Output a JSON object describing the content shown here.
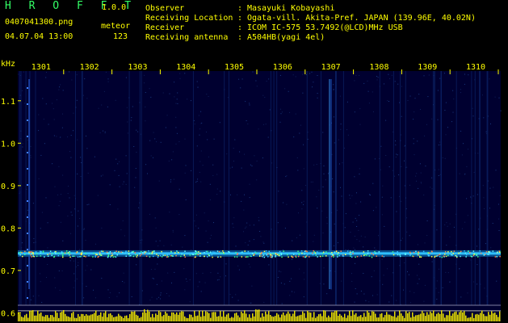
{
  "header": {
    "app_name": "H R O F F T",
    "version": "1.0.0",
    "filename": "0407041300.png",
    "meteor_label": "meteor",
    "datetime": "04.07.04 13:00",
    "meteor_count": "123"
  },
  "info": [
    {
      "key": "Observer",
      "value": "Masayuki Kobayashi"
    },
    {
      "key": "Receiving Location",
      "value": "Ogata-vill. Akita-Pref. JAPAN (139.96E, 40.02N)"
    },
    {
      "key": "Receiver",
      "value": "ICOM IC-575 53.7492(@LCD)MHz USB"
    },
    {
      "key": "Receiving antenna",
      "value": "A504HB(yagi 4el)"
    }
  ],
  "colors": {
    "text": "#ffff00",
    "title": "#33ff66",
    "background": "#000000",
    "spectrum_bg": "#000030",
    "echo_line": "#30c0ff"
  },
  "chart_data": {
    "type": "heatmap",
    "ylabel": "kHz",
    "y_ticks": [
      "1.1",
      "1.0",
      "0.9",
      "0.8",
      "0.7",
      "0.6"
    ],
    "x_ticks": [
      "1301",
      "1302",
      "1303",
      "1304",
      "1305",
      "1306",
      "1307",
      "1308",
      "1309",
      "1310"
    ],
    "carrier_frequency_khz": 0.74,
    "ylim": [
      0.58,
      1.17
    ]
  }
}
